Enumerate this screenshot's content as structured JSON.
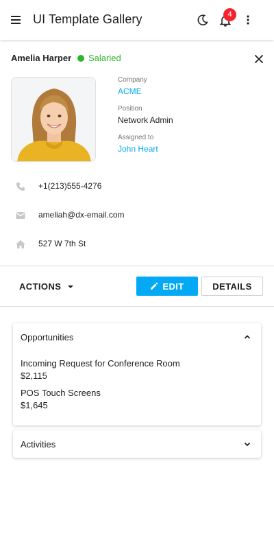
{
  "app": {
    "title": "UI Template Gallery",
    "notification_count": "4"
  },
  "contact": {
    "name": "Amelia Harper",
    "status": "Salaried",
    "status_color": "#2eb52c",
    "company_label": "Company",
    "company": "ACME",
    "position_label": "Position",
    "position": "Network Admin",
    "assigned_label": "Assigned to",
    "assigned": "John Heart",
    "phone": "+1(213)555-4276",
    "email": "ameliah@dx-email.com",
    "address": "527 W 7th St"
  },
  "toolbar": {
    "actions_label": "ACTIONS",
    "edit_label": "EDIT",
    "details_label": "DETAILS"
  },
  "opportunities": {
    "title": "Opportunities",
    "expanded": true,
    "items": [
      {
        "title": "Incoming Request for Conference Room",
        "amount": "$2,115"
      },
      {
        "title": "POS Touch Screens",
        "amount": "$1,645"
      }
    ]
  },
  "activities": {
    "title": "Activities",
    "expanded": false
  },
  "colors": {
    "accent": "#03a9f4",
    "badge": "#f5222d",
    "icon": "#c8c8c8"
  },
  "icons": [
    "menu-icon",
    "moon-icon",
    "bell-icon",
    "more-vert-icon",
    "close-icon",
    "phone-icon",
    "email-icon",
    "home-icon",
    "pencil-icon",
    "chevron-up-icon",
    "chevron-down-icon"
  ]
}
